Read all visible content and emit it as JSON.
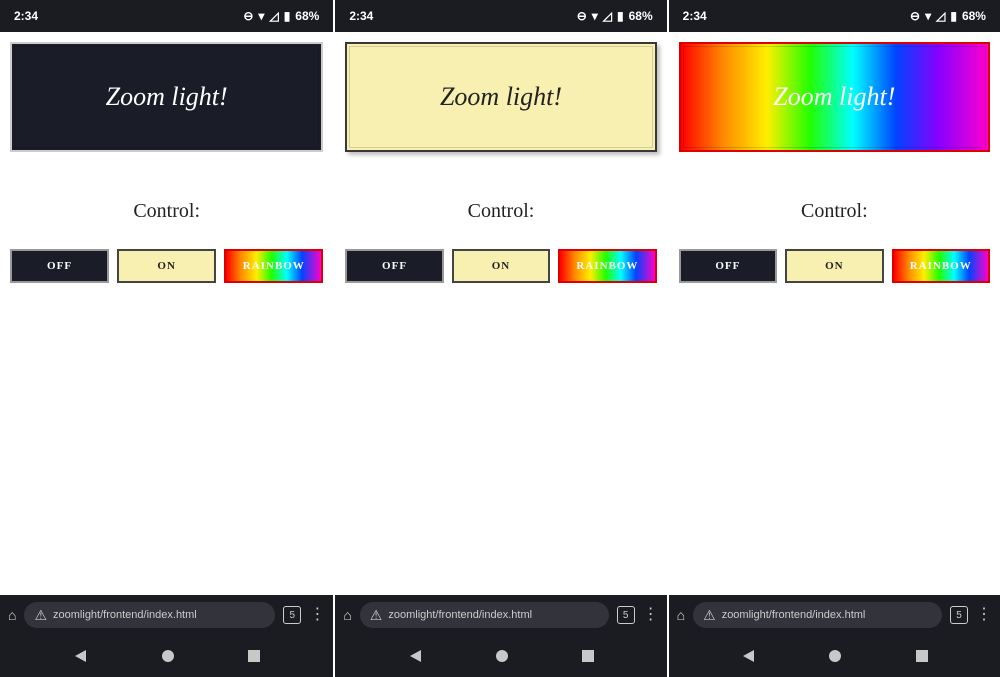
{
  "status": {
    "time": "2:34",
    "dnd_icon": "⊖",
    "wifi_icon": "▾",
    "signal_icon": "◿",
    "battery_icon": "▮",
    "battery_text": "68%"
  },
  "app": {
    "banner_label": "Zoom light!",
    "control_heading": "Control:",
    "buttons": {
      "off": "OFF",
      "on": "ON",
      "rainbow": "RAINBOW"
    }
  },
  "browser": {
    "url": "zoomlight/frontend/index.html",
    "tab_count": "5"
  },
  "phones": [
    {
      "state": "off"
    },
    {
      "state": "on"
    },
    {
      "state": "rainbow"
    }
  ]
}
